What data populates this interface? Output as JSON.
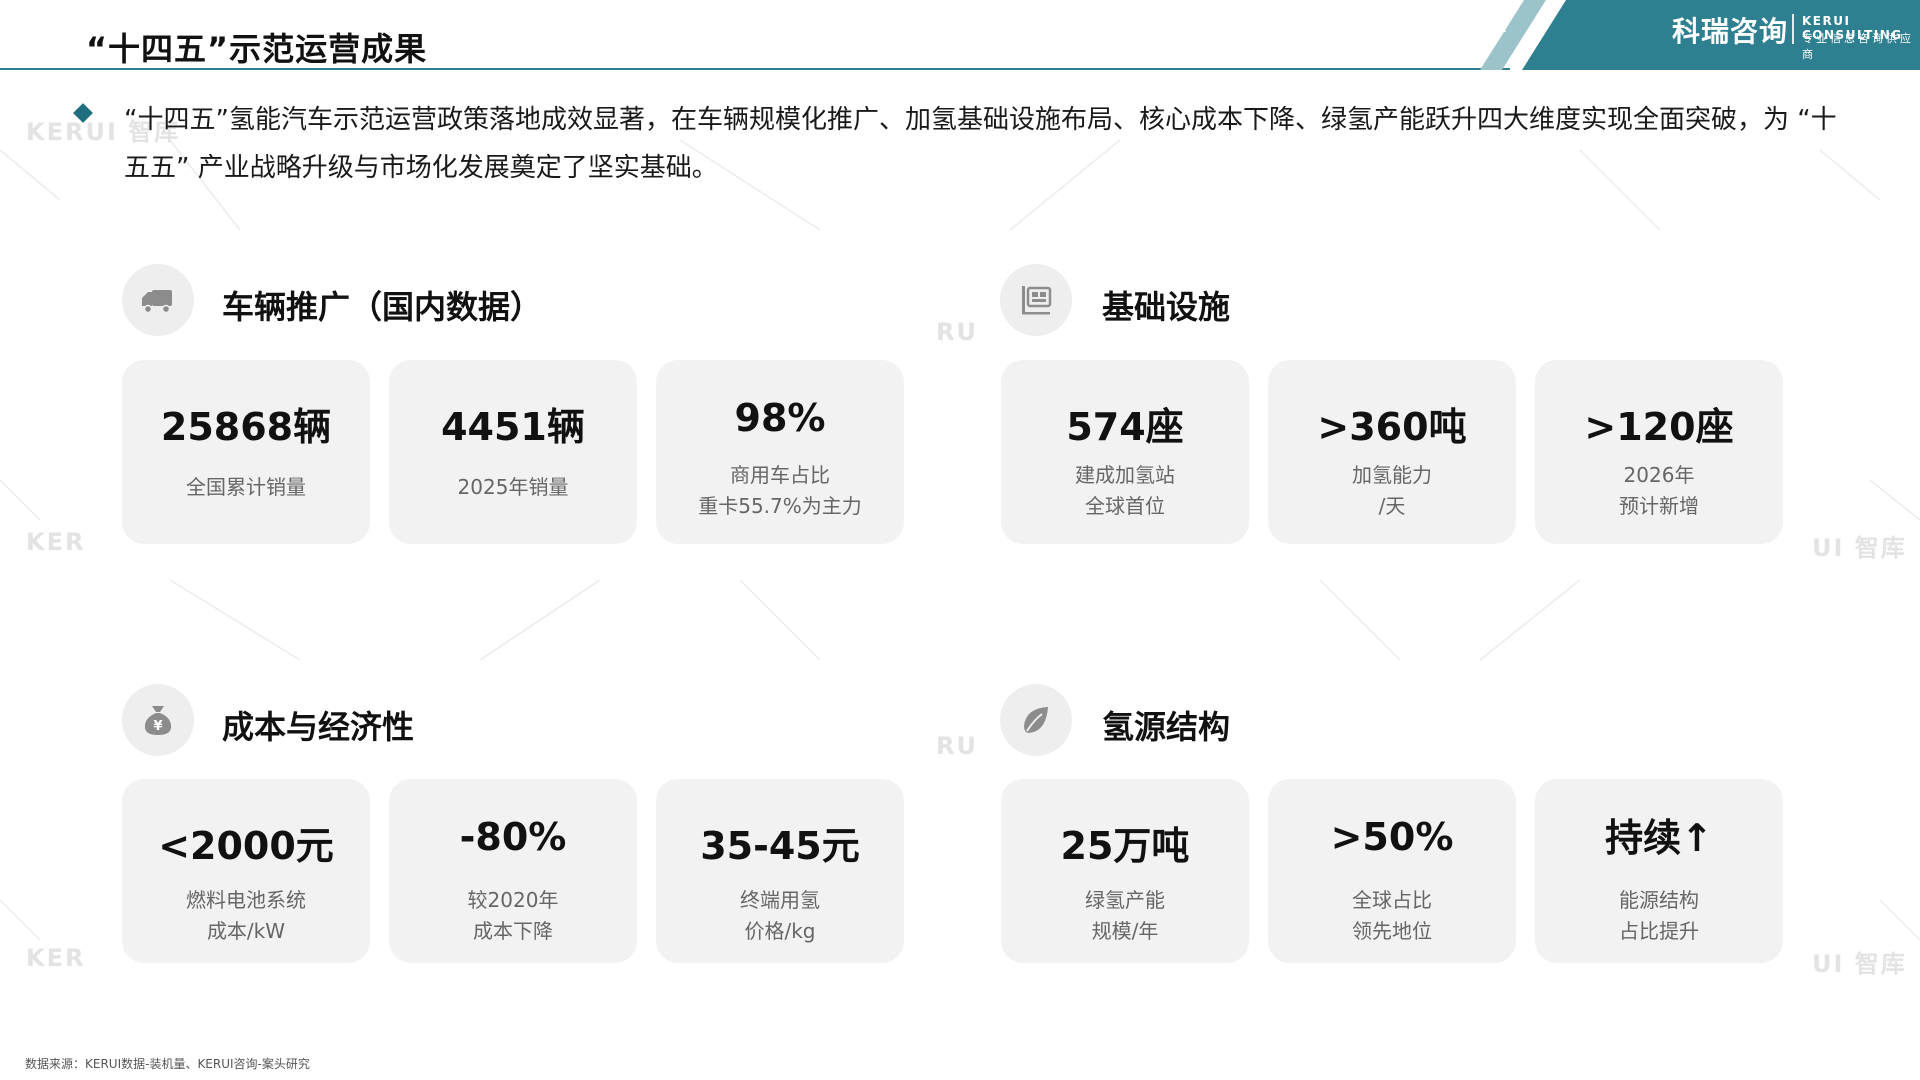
{
  "header": {
    "title": "“十四五”示范运营成果",
    "brand_name": "科瑞咨询",
    "brand_en": "KERUI CONSULTING",
    "brand_tagline": "专业信息咨询供应商",
    "accent_color": "#2e7f8f"
  },
  "intro": {
    "text": "“十四五”氢能汽车示范运营政策落地成效显著，在车辆规模化推广、加氢基础设施布局、核心成本下降、绿氢产能跃升四大维度实现全面突破，为 “十五五” 产业战略升级与市场化发展奠定了坚实基础。"
  },
  "watermark": {
    "texts": [
      "KERUI 智库",
      "RU",
      "KER",
      "UI 智库"
    ]
  },
  "sections": [
    {
      "title": "车辆推广（国内数据）",
      "icon": "truck-icon",
      "cards": [
        {
          "value": "25868辆",
          "label1": "全国累计销量",
          "label2": ""
        },
        {
          "value": "4451辆",
          "label1": "2025年销量",
          "label2": ""
        },
        {
          "value": "98%",
          "label1": "商用车占比",
          "label2": "重卡55.7%为主力"
        }
      ]
    },
    {
      "title": "基础设施",
      "icon": "station-icon",
      "cards": [
        {
          "value": "574座",
          "label1": "建成加氢站",
          "label2": "全球首位"
        },
        {
          "value": ">360吨",
          "label1": "加氢能力",
          "label2": "/天"
        },
        {
          "value": ">120座",
          "label1": "2026年",
          "label2": "预计新增"
        }
      ]
    },
    {
      "title": "成本与经济性",
      "icon": "money-bag-icon",
      "cards": [
        {
          "value": "<2000元",
          "label1": "燃料电池系统",
          "label2": "成本/kW"
        },
        {
          "value": "-80%",
          "label1": "较2020年",
          "label2": "成本下降"
        },
        {
          "value": "35-45元",
          "label1": "终端用氢",
          "label2": "价格/kg"
        }
      ]
    },
    {
      "title": "氢源结构",
      "icon": "leaf-icon",
      "cards": [
        {
          "value": "25万吨",
          "label1": "绿氢产能",
          "label2": "规模/年"
        },
        {
          "value": ">50%",
          "label1": "全球占比",
          "label2": "领先地位"
        },
        {
          "value": "持续↑",
          "label1": "能源结构",
          "label2": "占比提升"
        }
      ]
    }
  ],
  "footer": {
    "source": "数据来源：KERUI数据-装机量、KERUI咨询-案头研究"
  }
}
